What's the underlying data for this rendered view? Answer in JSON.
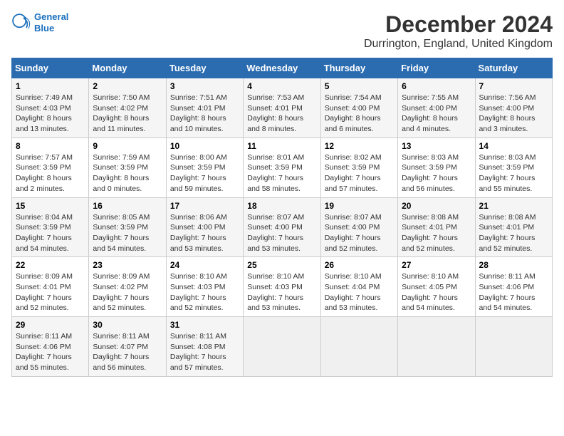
{
  "header": {
    "logo_line1": "General",
    "logo_line2": "Blue",
    "month": "December 2024",
    "location": "Durrington, England, United Kingdom"
  },
  "weekdays": [
    "Sunday",
    "Monday",
    "Tuesday",
    "Wednesday",
    "Thursday",
    "Friday",
    "Saturday"
  ],
  "weeks": [
    [
      {
        "day": "1",
        "sunrise": "Sunrise: 7:49 AM",
        "sunset": "Sunset: 4:03 PM",
        "daylight": "Daylight: 8 hours and 13 minutes."
      },
      {
        "day": "2",
        "sunrise": "Sunrise: 7:50 AM",
        "sunset": "Sunset: 4:02 PM",
        "daylight": "Daylight: 8 hours and 11 minutes."
      },
      {
        "day": "3",
        "sunrise": "Sunrise: 7:51 AM",
        "sunset": "Sunset: 4:01 PM",
        "daylight": "Daylight: 8 hours and 10 minutes."
      },
      {
        "day": "4",
        "sunrise": "Sunrise: 7:53 AM",
        "sunset": "Sunset: 4:01 PM",
        "daylight": "Daylight: 8 hours and 8 minutes."
      },
      {
        "day": "5",
        "sunrise": "Sunrise: 7:54 AM",
        "sunset": "Sunset: 4:00 PM",
        "daylight": "Daylight: 8 hours and 6 minutes."
      },
      {
        "day": "6",
        "sunrise": "Sunrise: 7:55 AM",
        "sunset": "Sunset: 4:00 PM",
        "daylight": "Daylight: 8 hours and 4 minutes."
      },
      {
        "day": "7",
        "sunrise": "Sunrise: 7:56 AM",
        "sunset": "Sunset: 4:00 PM",
        "daylight": "Daylight: 8 hours and 3 minutes."
      }
    ],
    [
      {
        "day": "8",
        "sunrise": "Sunrise: 7:57 AM",
        "sunset": "Sunset: 3:59 PM",
        "daylight": "Daylight: 8 hours and 2 minutes."
      },
      {
        "day": "9",
        "sunrise": "Sunrise: 7:59 AM",
        "sunset": "Sunset: 3:59 PM",
        "daylight": "Daylight: 8 hours and 0 minutes."
      },
      {
        "day": "10",
        "sunrise": "Sunrise: 8:00 AM",
        "sunset": "Sunset: 3:59 PM",
        "daylight": "Daylight: 7 hours and 59 minutes."
      },
      {
        "day": "11",
        "sunrise": "Sunrise: 8:01 AM",
        "sunset": "Sunset: 3:59 PM",
        "daylight": "Daylight: 7 hours and 58 minutes."
      },
      {
        "day": "12",
        "sunrise": "Sunrise: 8:02 AM",
        "sunset": "Sunset: 3:59 PM",
        "daylight": "Daylight: 7 hours and 57 minutes."
      },
      {
        "day": "13",
        "sunrise": "Sunrise: 8:03 AM",
        "sunset": "Sunset: 3:59 PM",
        "daylight": "Daylight: 7 hours and 56 minutes."
      },
      {
        "day": "14",
        "sunrise": "Sunrise: 8:03 AM",
        "sunset": "Sunset: 3:59 PM",
        "daylight": "Daylight: 7 hours and 55 minutes."
      }
    ],
    [
      {
        "day": "15",
        "sunrise": "Sunrise: 8:04 AM",
        "sunset": "Sunset: 3:59 PM",
        "daylight": "Daylight: 7 hours and 54 minutes."
      },
      {
        "day": "16",
        "sunrise": "Sunrise: 8:05 AM",
        "sunset": "Sunset: 3:59 PM",
        "daylight": "Daylight: 7 hours and 54 minutes."
      },
      {
        "day": "17",
        "sunrise": "Sunrise: 8:06 AM",
        "sunset": "Sunset: 4:00 PM",
        "daylight": "Daylight: 7 hours and 53 minutes."
      },
      {
        "day": "18",
        "sunrise": "Sunrise: 8:07 AM",
        "sunset": "Sunset: 4:00 PM",
        "daylight": "Daylight: 7 hours and 53 minutes."
      },
      {
        "day": "19",
        "sunrise": "Sunrise: 8:07 AM",
        "sunset": "Sunset: 4:00 PM",
        "daylight": "Daylight: 7 hours and 52 minutes."
      },
      {
        "day": "20",
        "sunrise": "Sunrise: 8:08 AM",
        "sunset": "Sunset: 4:01 PM",
        "daylight": "Daylight: 7 hours and 52 minutes."
      },
      {
        "day": "21",
        "sunrise": "Sunrise: 8:08 AM",
        "sunset": "Sunset: 4:01 PM",
        "daylight": "Daylight: 7 hours and 52 minutes."
      }
    ],
    [
      {
        "day": "22",
        "sunrise": "Sunrise: 8:09 AM",
        "sunset": "Sunset: 4:01 PM",
        "daylight": "Daylight: 7 hours and 52 minutes."
      },
      {
        "day": "23",
        "sunrise": "Sunrise: 8:09 AM",
        "sunset": "Sunset: 4:02 PM",
        "daylight": "Daylight: 7 hours and 52 minutes."
      },
      {
        "day": "24",
        "sunrise": "Sunrise: 8:10 AM",
        "sunset": "Sunset: 4:03 PM",
        "daylight": "Daylight: 7 hours and 52 minutes."
      },
      {
        "day": "25",
        "sunrise": "Sunrise: 8:10 AM",
        "sunset": "Sunset: 4:03 PM",
        "daylight": "Daylight: 7 hours and 53 minutes."
      },
      {
        "day": "26",
        "sunrise": "Sunrise: 8:10 AM",
        "sunset": "Sunset: 4:04 PM",
        "daylight": "Daylight: 7 hours and 53 minutes."
      },
      {
        "day": "27",
        "sunrise": "Sunrise: 8:10 AM",
        "sunset": "Sunset: 4:05 PM",
        "daylight": "Daylight: 7 hours and 54 minutes."
      },
      {
        "day": "28",
        "sunrise": "Sunrise: 8:11 AM",
        "sunset": "Sunset: 4:06 PM",
        "daylight": "Daylight: 7 hours and 54 minutes."
      }
    ],
    [
      {
        "day": "29",
        "sunrise": "Sunrise: 8:11 AM",
        "sunset": "Sunset: 4:06 PM",
        "daylight": "Daylight: 7 hours and 55 minutes."
      },
      {
        "day": "30",
        "sunrise": "Sunrise: 8:11 AM",
        "sunset": "Sunset: 4:07 PM",
        "daylight": "Daylight: 7 hours and 56 minutes."
      },
      {
        "day": "31",
        "sunrise": "Sunrise: 8:11 AM",
        "sunset": "Sunset: 4:08 PM",
        "daylight": "Daylight: 7 hours and 57 minutes."
      },
      null,
      null,
      null,
      null
    ]
  ]
}
